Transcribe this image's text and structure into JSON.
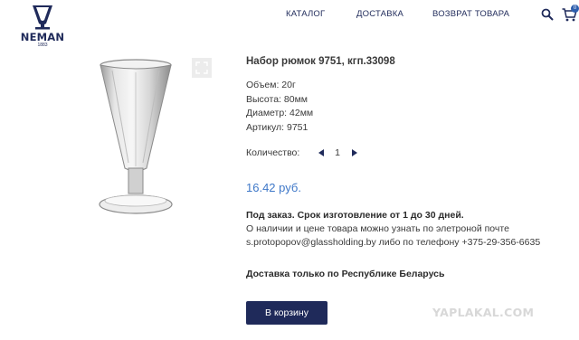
{
  "brand": {
    "name": "NEMAN",
    "year": "1883"
  },
  "nav": {
    "catalog": "КАТАЛОГ",
    "delivery": "ДОСТАВКА",
    "returns": "ВОЗВРАТ ТОВАРА"
  },
  "cart": {
    "count": "0"
  },
  "icons": {
    "search": "search-icon",
    "cart": "cart-icon",
    "zoom": "expand-icon"
  },
  "colors": {
    "brand_navy": "#1f2a5a",
    "price_blue": "#3f78c8",
    "badge_blue": "#2e5fae"
  },
  "product": {
    "title": "Набор рюмок 9751, кгп.33098",
    "specs": [
      "Объем: 20г",
      "Высота: 80мм",
      "Диаметр: 42мм",
      "Артикул: 9751"
    ],
    "quantity_label": "Количество:",
    "quantity": "1",
    "price": "16.42 руб.",
    "order_bold": "Под заказ. Срок изготовление от 1 до 30 дней.",
    "order_line1": "О наличии и цене товара можно узнать по элетроной почте",
    "order_line2": "s.protopopov@glassholding.by либо по телефону +375-29-356-6635",
    "delivery_note": "Доставка только по Республике Беларусь",
    "add_to_cart": "В корзину"
  },
  "watermark": "YAPLAKAL.COM"
}
